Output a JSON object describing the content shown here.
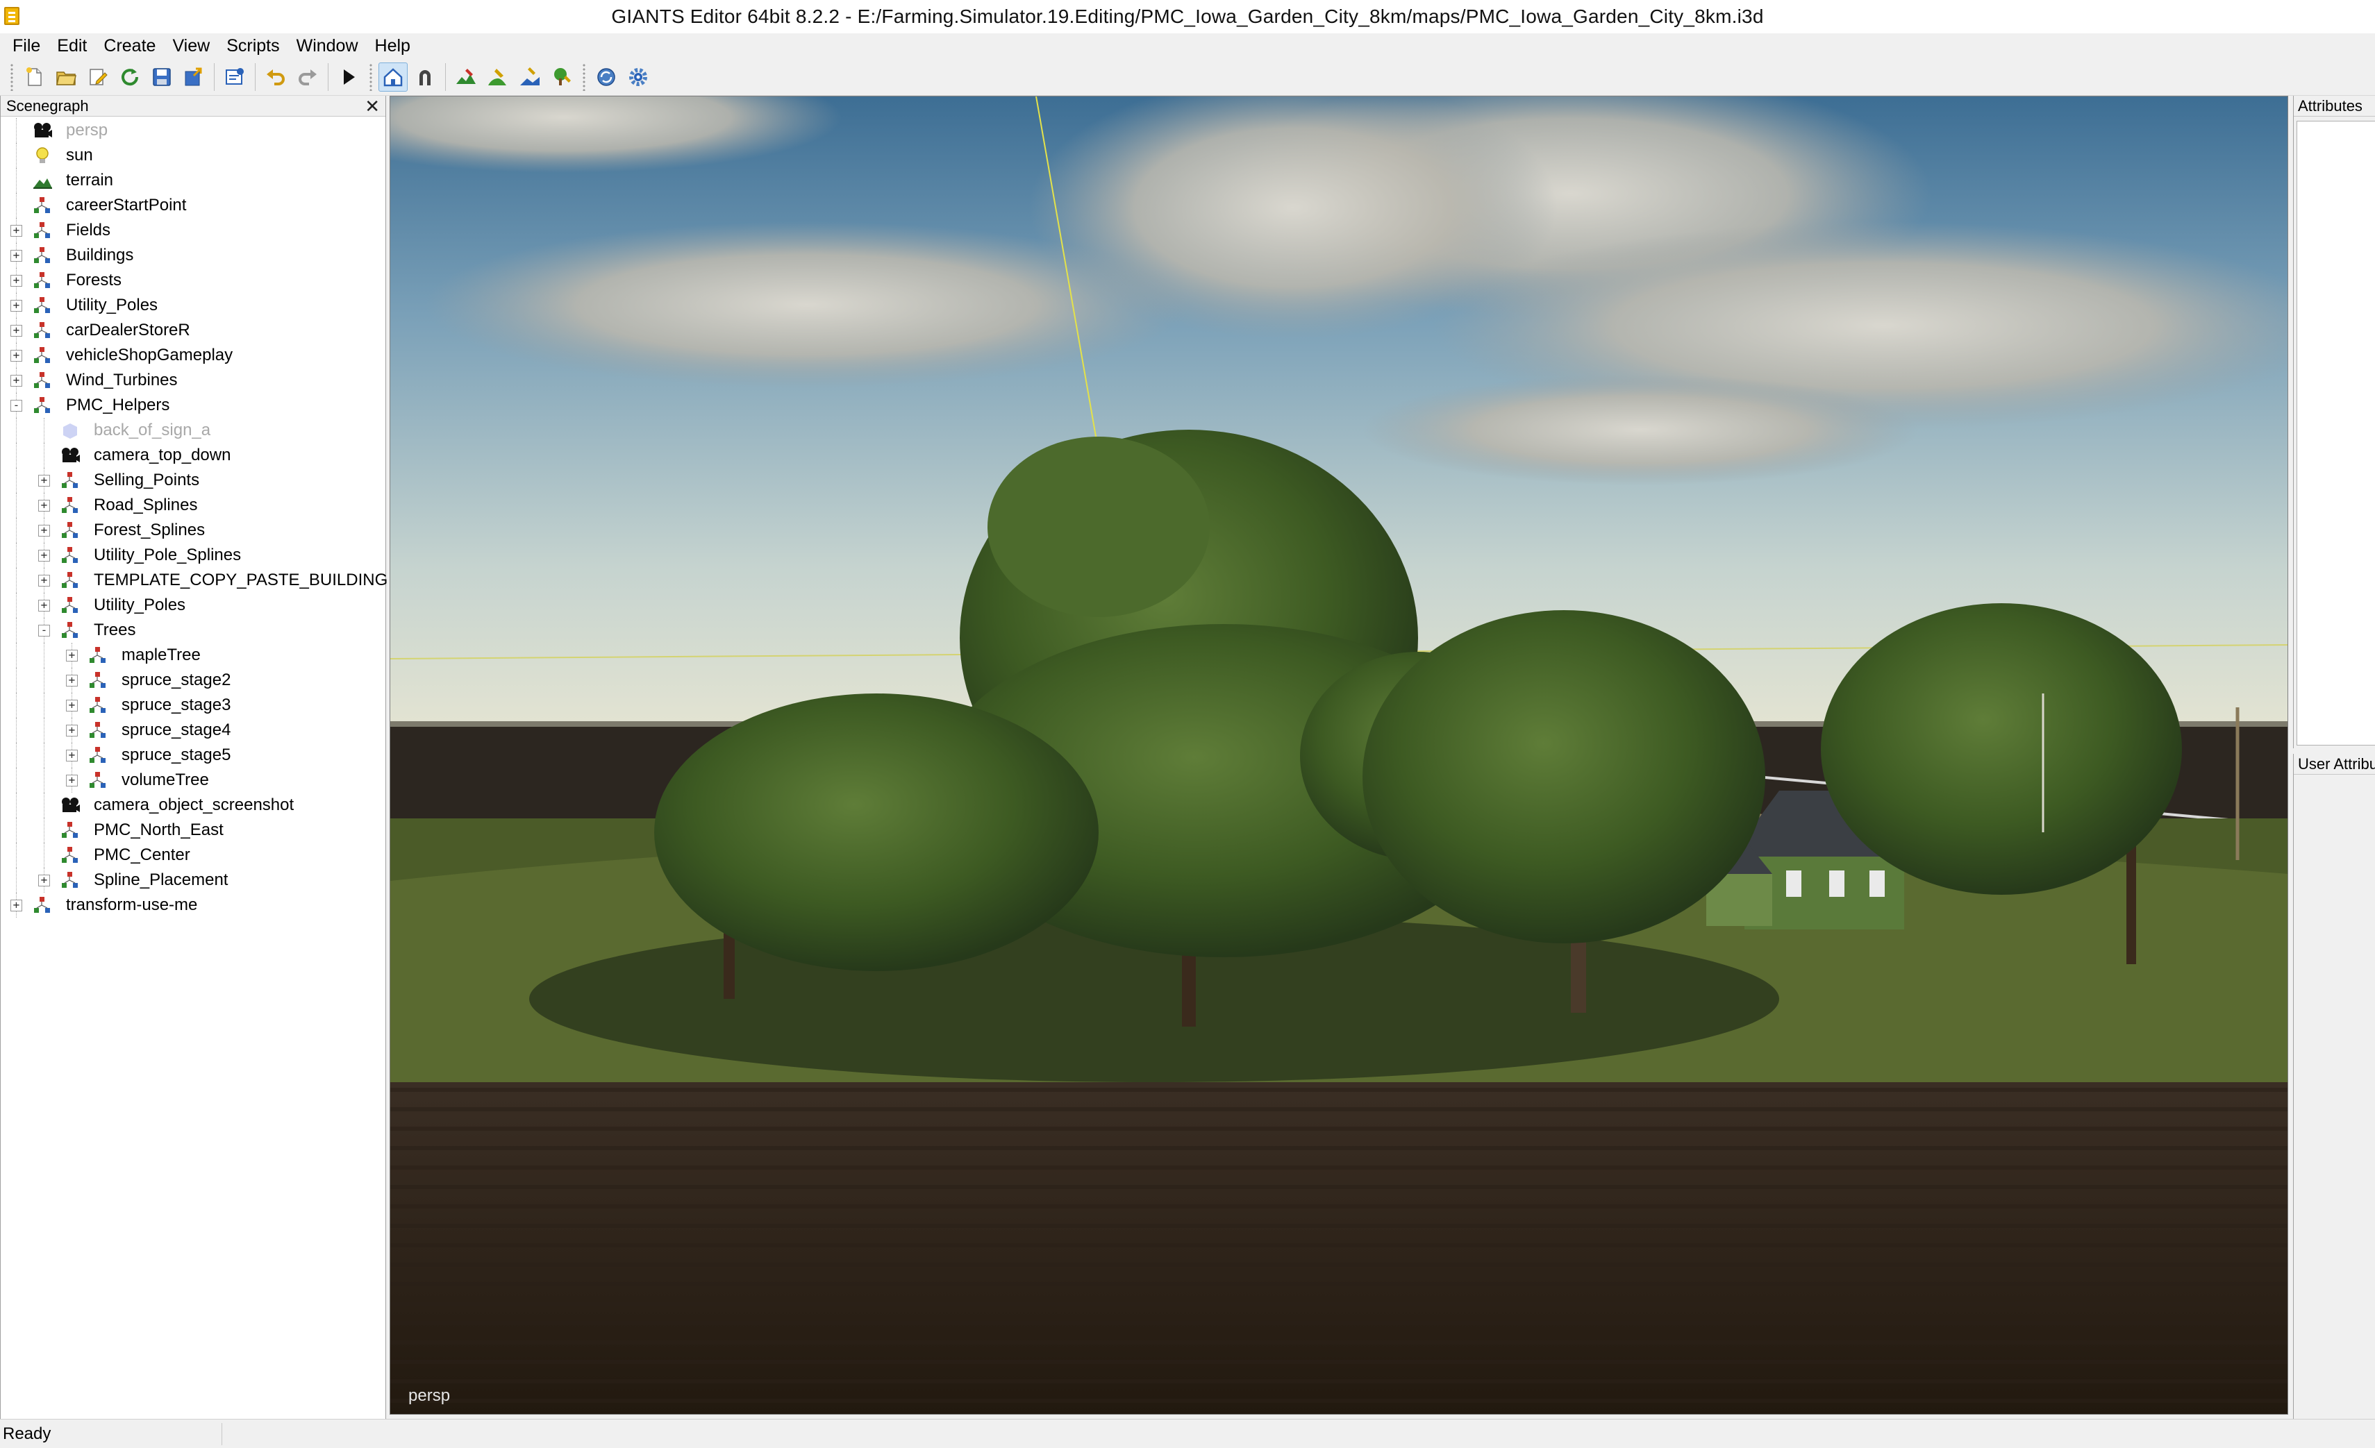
{
  "window": {
    "title": "GIANTS Editor 64bit 8.2.2 - E:/Farming.Simulator.19.Editing/PMC_Iowa_Garden_City_8km/maps/PMC_Iowa_Garden_City_8km.i3d"
  },
  "menu": [
    "File",
    "Edit",
    "Create",
    "View",
    "Scripts",
    "Window",
    "Help"
  ],
  "toolbar": {
    "buttons": [
      "new-file-icon",
      "open-file-icon",
      "edit-file-icon",
      "reload-icon",
      "save-icon",
      "export-icon",
      "import-icon",
      "undo-icon",
      "redo-icon",
      "play-icon",
      "home-camera-icon",
      "magnet-icon",
      "terrain-paint-icon",
      "foliage-paint-icon",
      "terrain-detail-icon",
      "tree-paint-icon",
      "refresh-scene-icon",
      "settings-gear-icon"
    ],
    "active_button": "home-camera-icon"
  },
  "scenegraph": {
    "title": "Scenegraph",
    "close_glyph": "✕",
    "nodes": [
      {
        "label": "persp",
        "type": "camera",
        "depth": 0,
        "expander": "",
        "dim": true
      },
      {
        "label": "sun",
        "type": "light",
        "depth": 0,
        "expander": ""
      },
      {
        "label": "terrain",
        "type": "terrain",
        "depth": 0,
        "expander": ""
      },
      {
        "label": "careerStartPoint",
        "type": "transform",
        "depth": 0,
        "expander": ""
      },
      {
        "label": "Fields",
        "type": "transform",
        "depth": 0,
        "expander": "+"
      },
      {
        "label": "Buildings",
        "type": "transform",
        "depth": 0,
        "expander": "+"
      },
      {
        "label": "Forests",
        "type": "transform",
        "depth": 0,
        "expander": "+"
      },
      {
        "label": "Utility_Poles",
        "type": "transform",
        "depth": 0,
        "expander": "+"
      },
      {
        "label": "carDealerStoreR",
        "type": "transform",
        "depth": 0,
        "expander": "+"
      },
      {
        "label": "vehicleShopGameplay",
        "type": "transform",
        "depth": 0,
        "expander": "+"
      },
      {
        "label": "Wind_Turbines",
        "type": "transform",
        "depth": 0,
        "expander": "+"
      },
      {
        "label": "PMC_Helpers",
        "type": "transform",
        "depth": 0,
        "expander": "-"
      },
      {
        "label": "back_of_sign_a",
        "type": "shape",
        "depth": 1,
        "expander": "",
        "dim": true
      },
      {
        "label": "camera_top_down",
        "type": "camera",
        "depth": 1,
        "expander": ""
      },
      {
        "label": "Selling_Points",
        "type": "transform",
        "depth": 1,
        "expander": "+"
      },
      {
        "label": "Road_Splines",
        "type": "transform",
        "depth": 1,
        "expander": "+"
      },
      {
        "label": "Forest_Splines",
        "type": "transform",
        "depth": 1,
        "expander": "+"
      },
      {
        "label": "Utility_Pole_Splines",
        "type": "transform",
        "depth": 1,
        "expander": "+"
      },
      {
        "label": "TEMPLATE_COPY_PASTE_BUILDING",
        "type": "transform",
        "depth": 1,
        "expander": "+"
      },
      {
        "label": "Utility_Poles",
        "type": "transform",
        "depth": 1,
        "expander": "+"
      },
      {
        "label": "Trees",
        "type": "transform",
        "depth": 1,
        "expander": "-"
      },
      {
        "label": "mapleTree",
        "type": "transform",
        "depth": 2,
        "expander": "+"
      },
      {
        "label": "spruce_stage2",
        "type": "transform",
        "depth": 2,
        "expander": "+"
      },
      {
        "label": "spruce_stage3",
        "type": "transform",
        "depth": 2,
        "expander": "+"
      },
      {
        "label": "spruce_stage4",
        "type": "transform",
        "depth": 2,
        "expander": "+"
      },
      {
        "label": "spruce_stage5",
        "type": "transform",
        "depth": 2,
        "expander": "+"
      },
      {
        "label": "volumeTree",
        "type": "transform",
        "depth": 2,
        "expander": "+"
      },
      {
        "label": "camera_object_screenshot",
        "type": "camera",
        "depth": 1,
        "expander": ""
      },
      {
        "label": "PMC_North_East",
        "type": "transform",
        "depth": 1,
        "expander": ""
      },
      {
        "label": "PMC_Center",
        "type": "transform",
        "depth": 1,
        "expander": ""
      },
      {
        "label": "Spline_Placement",
        "type": "transform",
        "depth": 1,
        "expander": "+"
      },
      {
        "label": "transform-use-me",
        "type": "transform",
        "depth": 0,
        "expander": "+"
      }
    ]
  },
  "viewport": {
    "camera_label": "persp"
  },
  "attributes_panel": {
    "title": "Attributes"
  },
  "user_attributes_panel": {
    "title": "User Attributes"
  },
  "status": {
    "text": "Ready"
  },
  "colors": {
    "icon_red": "#c8322a",
    "icon_green": "#2f8a2f",
    "icon_blue": "#2a62b8",
    "active_tool_bg": "#cfe4f7"
  }
}
